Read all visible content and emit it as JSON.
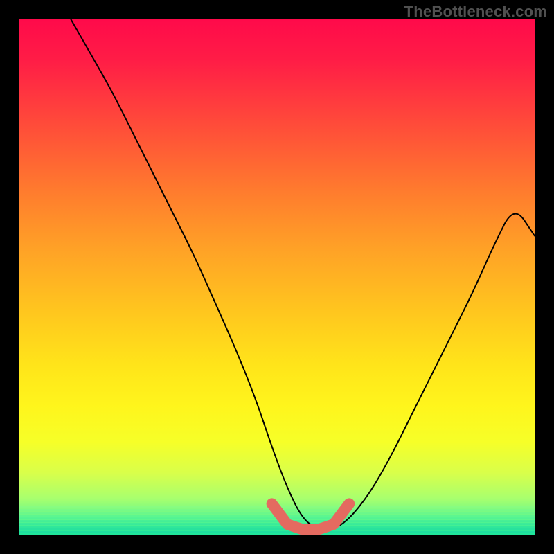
{
  "watermark": "TheBottleneck.com",
  "colors": {
    "frame_bg": "#000000",
    "highlight": "#e46a60",
    "curve": "#000000",
    "gradient_stops": [
      "#ff0a4a",
      "#ff1d46",
      "#ff4a3a",
      "#ff7a2e",
      "#ffa326",
      "#ffc71e",
      "#ffe41a",
      "#fff51c",
      "#f6ff28",
      "#d9ff4a",
      "#a8ff6e",
      "#5cf78e",
      "#1de59a"
    ]
  },
  "chart_data": {
    "type": "line",
    "title": "",
    "xlabel": "",
    "ylabel": "",
    "xlim": [
      0,
      100
    ],
    "ylim": [
      0,
      100
    ],
    "series": [
      {
        "name": "bottleneck-curve",
        "x": [
          10,
          14,
          18,
          22,
          26,
          30,
          34,
          38,
          42,
          46,
          49,
          52,
          55,
          58,
          61,
          64,
          68,
          72,
          76,
          80,
          84,
          88,
          92,
          96,
          100
        ],
        "y": [
          100,
          93,
          86,
          78,
          70,
          62,
          54,
          45,
          36,
          26,
          17,
          9,
          3,
          1,
          1,
          3,
          8,
          15,
          23,
          31,
          39,
          47,
          56,
          64,
          58
        ]
      },
      {
        "name": "highlight-segment",
        "x": [
          49,
          52,
          55,
          58,
          61,
          64
        ],
        "y": [
          6,
          2,
          1,
          1,
          2,
          6
        ]
      }
    ],
    "annotations": [
      {
        "text": "TheBottleneck.com",
        "role": "watermark",
        "position": "top-right"
      }
    ]
  }
}
